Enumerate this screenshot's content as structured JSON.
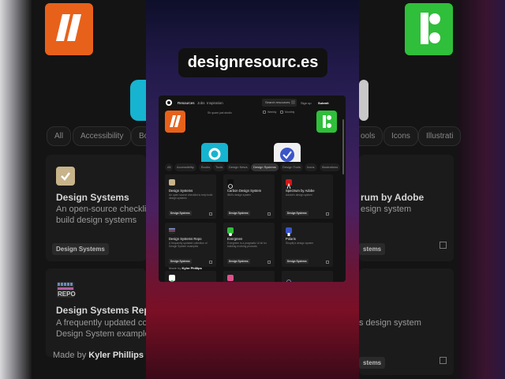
{
  "caption": "designresourc.es",
  "colors": {
    "orange": "#e8611a",
    "green": "#2fbf3a",
    "cyan": "#16b4d0",
    "blue": "#3a55c8",
    "red": "#d01a1a",
    "beige": "#c8b48a",
    "pink": "#e0508a"
  },
  "nav": {
    "resources": "Resources",
    "jobs": "Jobs",
    "inspiration": "Inspiration",
    "search_placeholder": "Search resources",
    "sign_up": "Sign up",
    "submit": "Submit"
  },
  "hero": {
    "note_left": "Sir quam just studio",
    "weekly": "Weekly",
    "monthly": "Monthly"
  },
  "chips": [
    "All",
    "Accessibility",
    "Books",
    "Tools",
    "Design News",
    "Design Systems",
    "Design Tools",
    "Icons",
    "Illustrations"
  ],
  "chips_active": "Design Systems",
  "cards": [
    {
      "title": "Design Systems",
      "desc": "An open source checklist to help build design systems",
      "tag": "Design Systems"
    },
    {
      "title": "Carbon Design System",
      "desc": "IBM's design system",
      "tag": "Design Systems"
    },
    {
      "title": "Spectrum by Adobe",
      "desc": "Adobe's design system",
      "tag": "Design Systems"
    },
    {
      "title": "Design Systems Repo",
      "desc": "A frequently updated collection of Design System examples",
      "tag": "Design Systems"
    },
    {
      "title": "Evergreen",
      "desc": "Evergreen is a pragmatic UI kit for building evolving products",
      "tag": "Design Systems"
    },
    {
      "title": "Polaris",
      "desc": "Shopify's design system",
      "tag": "Design Systems"
    }
  ],
  "madeby": {
    "label": "Made by",
    "name": "Kyler Phillips"
  },
  "background": {
    "chips": [
      "All",
      "Accessibility",
      "Bo",
      "ools",
      "Icons",
      "Illustrati"
    ],
    "left_card1_title": "Design Systems",
    "left_card1_desc1": "An open-source checklist to h",
    "left_card1_desc2": "build design systems",
    "left_card1_tag": "Design Systems",
    "repo_label": "REPO",
    "left_card2_title": "Design Systems Repo",
    "left_card2_desc1": "A frequently updated collect",
    "left_card2_desc2": "Design System examples",
    "madeby_label": "Made by",
    "madeby_name": "Kyler Phillips",
    "right_card1_title": "rum by Adobe",
    "right_card1_desc": "esign system",
    "right_card2_desc": "s design system",
    "right_tag": "stems"
  }
}
